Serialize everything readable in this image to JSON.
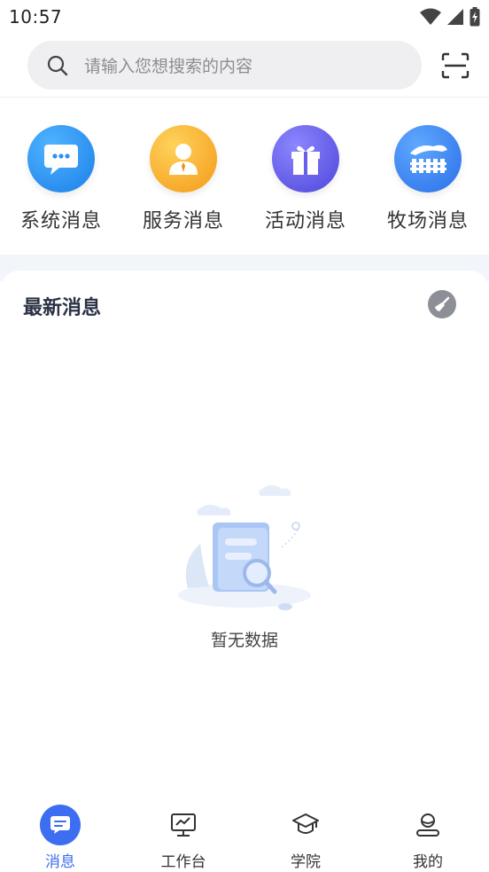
{
  "status_bar": {
    "time": "10:57"
  },
  "search": {
    "placeholder": "请输入您想搜索的内容"
  },
  "categories": [
    {
      "label": "系统消息",
      "icon": "chat-bubble-icon",
      "color": "#2f8ff2"
    },
    {
      "label": "服务消息",
      "icon": "service-person-icon",
      "color": "#f5a623"
    },
    {
      "label": "活动消息",
      "icon": "gift-icon",
      "color": "#6a62e6"
    },
    {
      "label": "牧场消息",
      "icon": "fence-icon",
      "color": "#3a7ff0"
    }
  ],
  "latest": {
    "title": "最新消息",
    "clear_icon": "broom-icon",
    "empty_text": "暂无数据"
  },
  "nav": {
    "items": [
      {
        "label": "消息",
        "icon": "message-icon",
        "active": true
      },
      {
        "label": "工作台",
        "icon": "monitor-chart-icon",
        "active": false
      },
      {
        "label": "学院",
        "icon": "graduation-cap-icon",
        "active": false
      },
      {
        "label": "我的",
        "icon": "person-icon",
        "active": false
      }
    ]
  },
  "colors": {
    "accent": "#3d6df0",
    "background_band": "#f2f5f9"
  }
}
